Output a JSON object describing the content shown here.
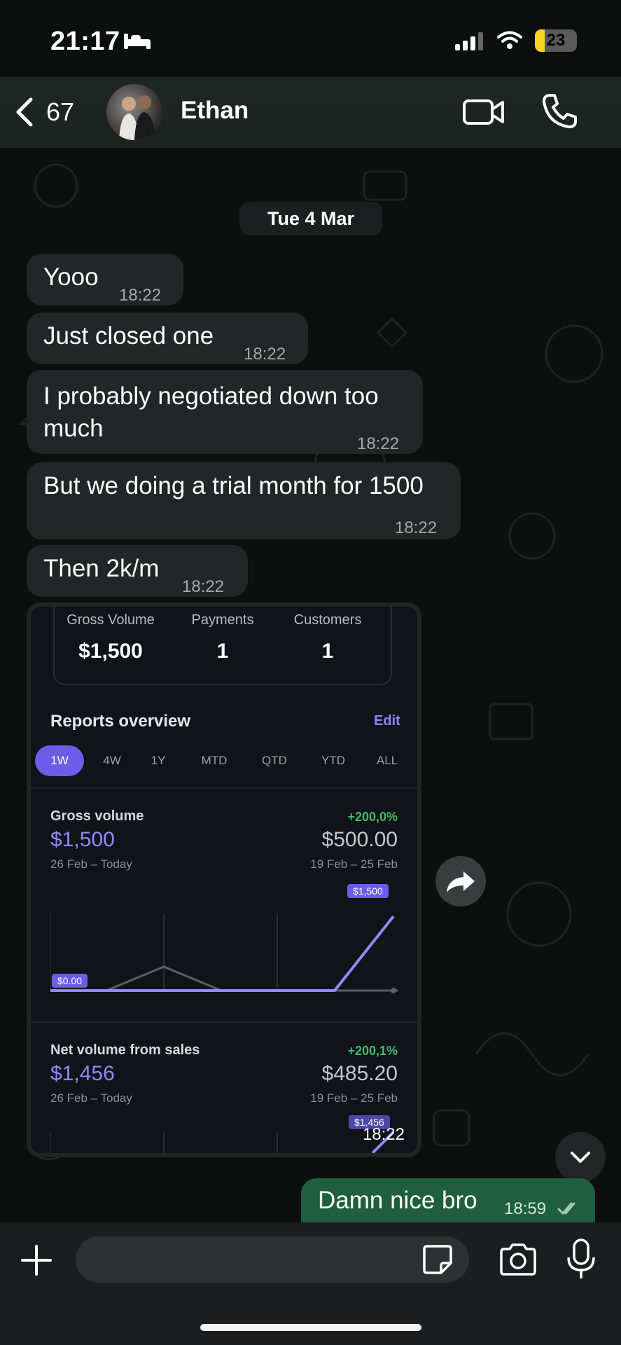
{
  "status": {
    "time": "21:17",
    "battery": "23"
  },
  "header": {
    "back_count": "67",
    "contact_name": "Ethan"
  },
  "date_separator": "Tue 4 Mar",
  "messages": [
    {
      "text": "Yooo",
      "time": "18:22"
    },
    {
      "text": "Just closed one",
      "time": "18:22"
    },
    {
      "text": "I probably negotiated down too",
      "text2": "much",
      "time": "18:22"
    },
    {
      "text": "But we doing a trial month for 1500",
      "time": "18:22"
    },
    {
      "text": "Then 2k/m",
      "time": "18:22"
    }
  ],
  "media": {
    "time": "18:22",
    "stats": [
      {
        "label": "Gross Volume",
        "value": "$1,500"
      },
      {
        "label": "Payments",
        "value": "1"
      },
      {
        "label": "Customers",
        "value": "1"
      }
    ],
    "reports_title": "Reports overview",
    "edit_label": "Edit",
    "periods": [
      "1W",
      "4W",
      "1Y",
      "MTD",
      "QTD",
      "YTD",
      "ALL"
    ],
    "gross": {
      "title": "Gross volume",
      "pct": "+200,0%",
      "value": "$1,500",
      "prev_value": "$500.00",
      "range": "26 Feb – Today",
      "prev_range": "19 Feb – 25 Feb",
      "tag_high": "$1,500",
      "tag_low": "$0.00"
    },
    "net": {
      "title": "Net volume from sales",
      "pct": "+200,1%",
      "value": "$1,456",
      "prev_value": "$485.20",
      "range": "26 Feb – Today",
      "prev_range": "19 Feb – 25 Feb",
      "tag_high": "$1,456"
    }
  },
  "outgoing": {
    "text": "Damn nice bro",
    "time": "18:59"
  },
  "colors": {
    "incoming_bubble": "#232527",
    "outgoing_bubble": "#1f5f3e",
    "accent_purple": "#6c5ce7",
    "positive_green": "#3fbc6a"
  }
}
